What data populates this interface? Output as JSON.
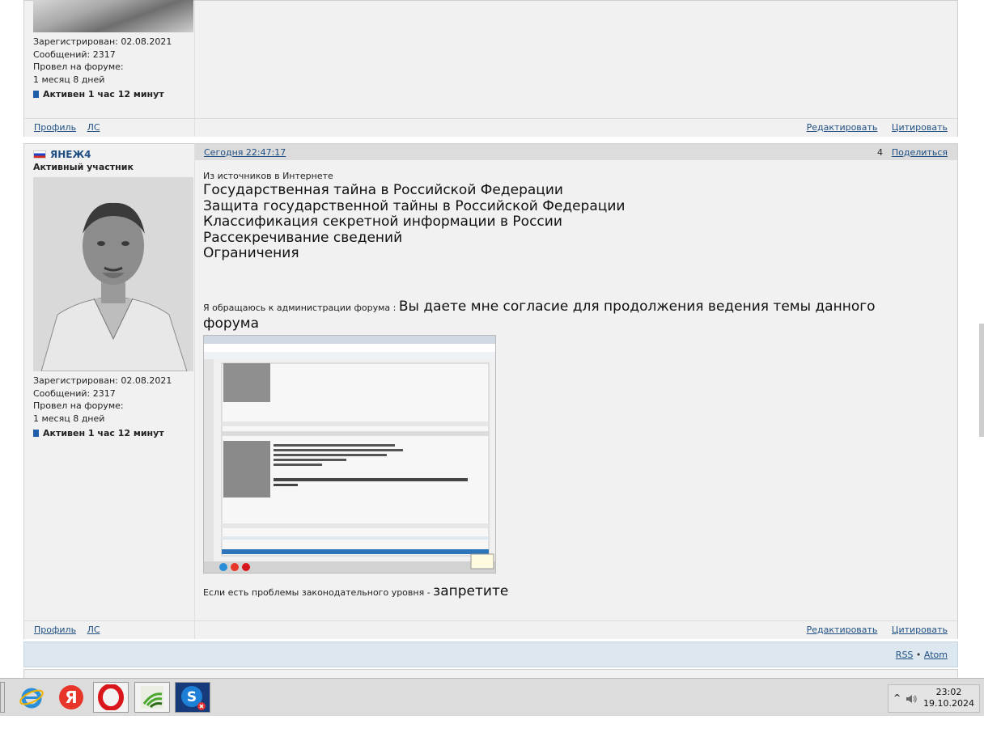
{
  "prev_post": {
    "registered": "Зарегистрирован: 02.08.2021",
    "messages": "Сообщений: 2317",
    "forum_time_label": "Провел на форуме:",
    "forum_time_value": "1 месяц 8 дней",
    "online": "Активен 1 час 12 минут",
    "footer": {
      "profile": "Профиль",
      "pm": "ЛС",
      "edit": "Редактировать",
      "quote": "Цитировать"
    }
  },
  "post": {
    "author": "ЯНЕЖ4",
    "rank": "Активный участник",
    "timestamp": "Сегодня 22:47:17",
    "number": "4",
    "share": "Поделиться",
    "registered": "Зарегистрирован: 02.08.2021",
    "messages": "Сообщений: 2317",
    "forum_time_label": "Провел на форуме:",
    "forum_time_value": "1 месяц 8 дней",
    "online": "Активен 1 час 12 минут",
    "source_line": "Из источников в Интернете",
    "headlines": [
      "Государственная тайна в Российской Федерации",
      "Защита государственной тайны в Российской Федерации",
      "Классификация секретной информации в России",
      "Рассекречивание сведений",
      "Ограничения"
    ],
    "appeal_small": "Я обращаюсь к администрации форума :",
    "appeal_big": "Вы даете  мне согласие для продолжения ведения темы данного форума",
    "closing_small": "Если есть проблемы законодательного уровня -",
    "closing_big": "запретите",
    "footer": {
      "profile": "Профиль",
      "pm": "ЛС",
      "edit": "Редактировать",
      "quote": "Цитировать"
    }
  },
  "bottom_bar": {
    "rss": "RSS",
    "sep": "•",
    "atom": "Atom"
  },
  "taskbar": {
    "icons": [
      "internet-explorer-icon",
      "yandex-browser-icon",
      "opera-icon",
      "wifi-app-icon",
      "skype-icon"
    ],
    "time": "23:02",
    "date": "19.10.2024",
    "tray_arrow": "^",
    "colors": {
      "yandex": "#e8352a",
      "opera": "#d8161b",
      "skype": "#1d7fd6",
      "ie": "#2a8fd8"
    }
  }
}
